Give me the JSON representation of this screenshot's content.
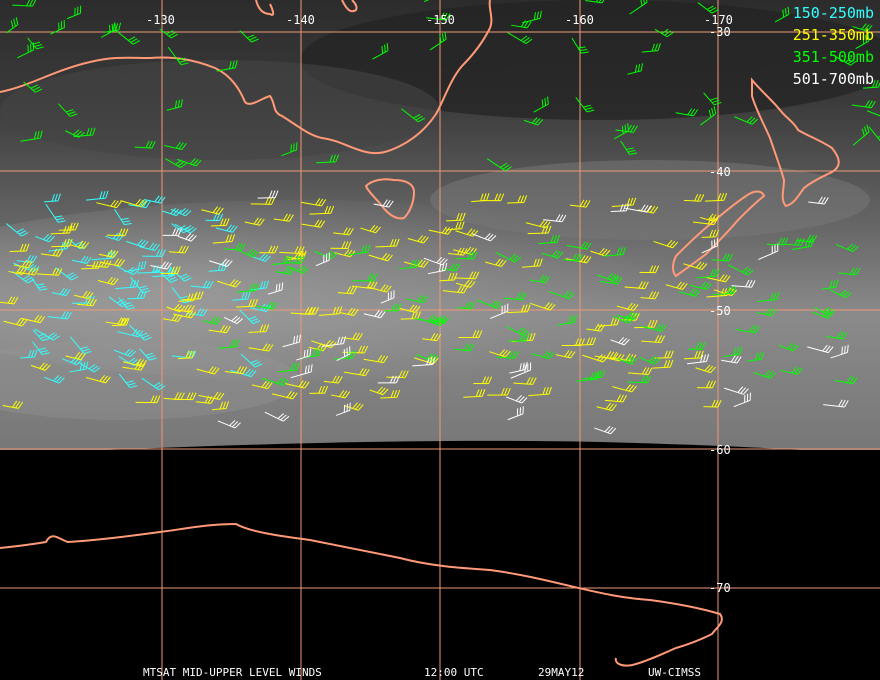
{
  "legend": {
    "items": [
      {
        "label": "150-250mb",
        "color": "#33ffff"
      },
      {
        "label": "251-350mb",
        "color": "#ffff00"
      },
      {
        "label": "351-500mb",
        "color": "#00ff00"
      },
      {
        "label": "501-700mb",
        "color": "#ffffff"
      }
    ]
  },
  "grid": {
    "longitude_labels": [
      "-130",
      "-140",
      "-150",
      "-160",
      "-170"
    ],
    "latitude_labels": [
      "-30",
      "-40",
      "-50",
      "-60",
      "-70"
    ],
    "line_color": "#ee9977"
  },
  "coast_color": "#ff9977",
  "footer": {
    "product": "MTSAT MID-UPPER LEVEL WINDS",
    "time": "12:00 UTC",
    "date": "29MAY12",
    "credit": "UW-CIMSS"
  }
}
